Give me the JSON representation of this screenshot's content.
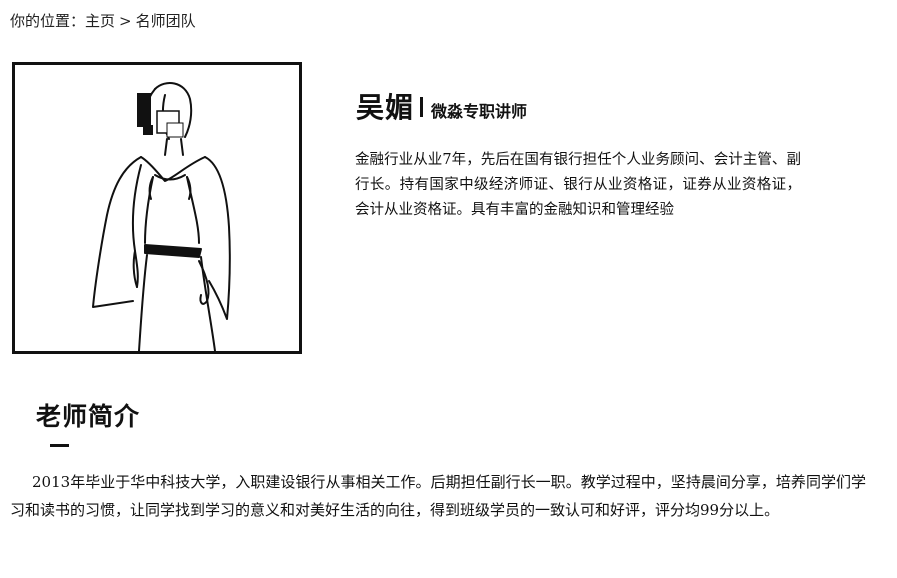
{
  "breadcrumb": {
    "prefix": "你的位置：",
    "home": "主页",
    "separator": ">",
    "current": "名师团队"
  },
  "teacher": {
    "name": "吴媚",
    "title": "微淼专职讲师",
    "summary": "金融行业从业7年，先后在国有银行担任个人业务顾问、会计主管、副行长。持有国家中级经济师证、银行从业资格证，证券从业资格证，会计从业资格证。具有丰富的金融知识和管理经验"
  },
  "intro": {
    "heading": "老师简介",
    "body": "2013年毕业于华中科技大学，入职建设银行从事相关工作。后期担任副行长一职。教学过程中，坚持晨间分享，培养同学们学习和读书的习惯，让同学找到学习的意义和对美好生活的向往，得到班级学员的一致认可和好评，评分均99分以上。"
  }
}
